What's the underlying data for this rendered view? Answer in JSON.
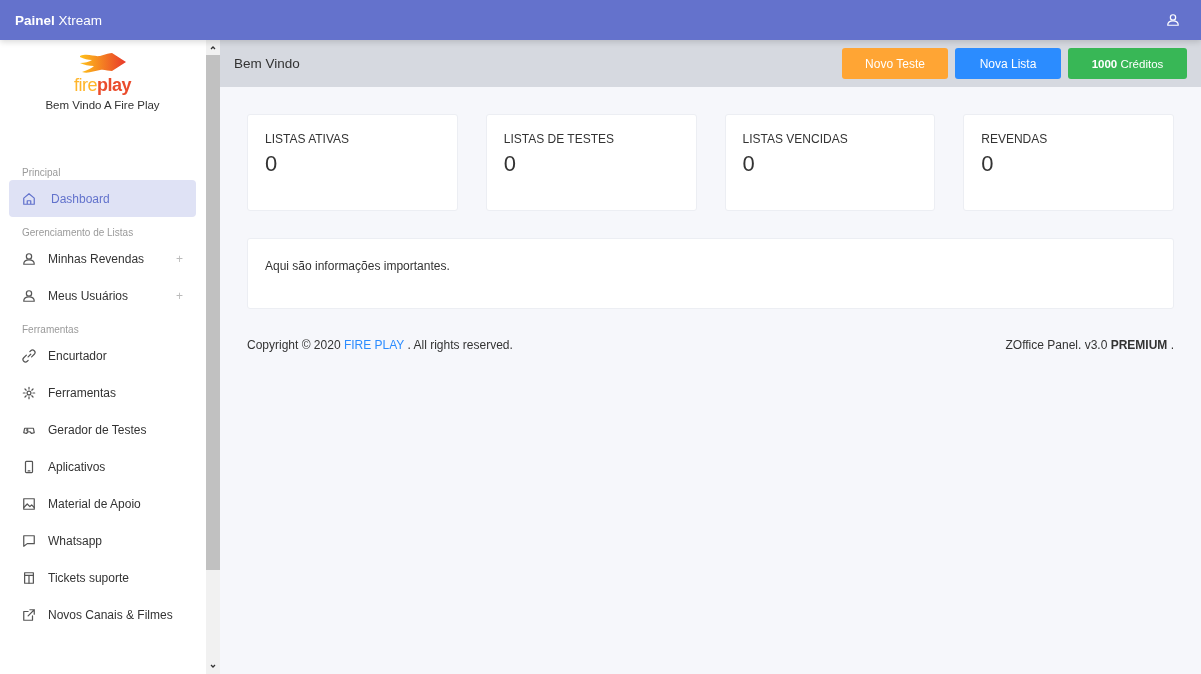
{
  "header": {
    "brand": "**Painel** Xtream"
  },
  "sidebar": {
    "logo_parts": [
      "fire",
      "play"
    ],
    "welcome": "Bem Vindo A Fire Play",
    "sections": [
      {
        "title": "Principal",
        "items": [
          {
            "label": "Dashboard",
            "selected": true
          }
        ]
      },
      {
        "title": "Gerenciamento de Listas",
        "items": [
          {
            "label": "Minhas Revendas",
            "selected": false,
            "badge": "+"
          },
          {
            "label": "Meus Usuários",
            "selected": false,
            "badge": "+"
          }
        ]
      },
      {
        "title": "Ferramentas",
        "items": [
          {
            "label": "Encurtador",
            "selected": false
          },
          {
            "label": "Ferramentas",
            "selected": false
          },
          {
            "label": "Gerador de Testes",
            "selected": false
          },
          {
            "label": "Aplicativos",
            "selected": false
          },
          {
            "label": "Material de Apoio",
            "selected": false
          },
          {
            "label": "Whatsapp",
            "selected": false
          },
          {
            "label": "Tickets suporte",
            "selected": false
          },
          {
            "label": "Novos Canais & Filmes",
            "selected": false
          }
        ]
      }
    ]
  },
  "page_title": "Bem Vindo",
  "buttons": [
    {
      "label": "Novo Teste",
      "color": "#ffa534"
    },
    {
      "label": "Nova Lista",
      "color": "#2b8cff"
    },
    {
      "label": "**1000** Créditos",
      "color": "#38b756"
    }
  ],
  "stats": [
    {
      "label": "LISTAS ATIVAS",
      "value": "0"
    },
    {
      "label": "LISTAS DE TESTES",
      "value": "0"
    },
    {
      "label": "LISTAS VENCIDAS",
      "value": "0"
    },
    {
      "label": "REVENDAS",
      "value": "0"
    }
  ],
  "info": "Aqui são informações importantes.",
  "footer": {
    "copyright_prefix": "Copyright © 2020",
    "link": "FIRE PLAY",
    "copyright_suffix": ". All rights reserved.",
    "version": "ZOffice Panel. v3.0 **PREMIUM** ."
  }
}
